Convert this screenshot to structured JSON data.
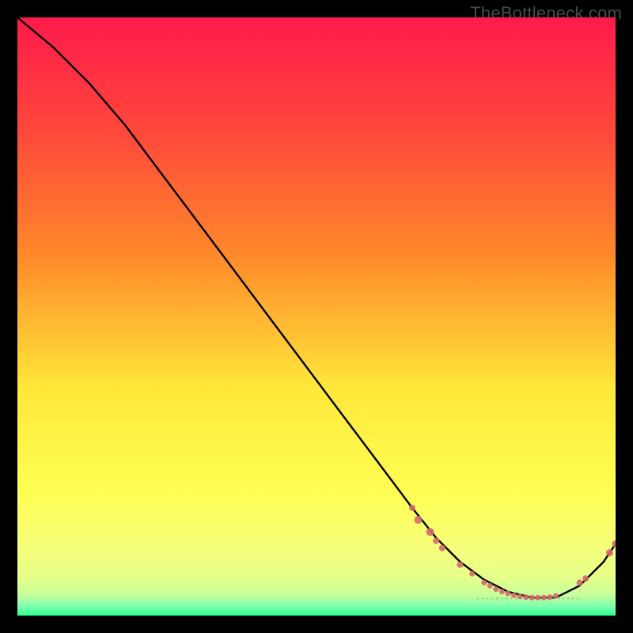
{
  "watermark": "TheBottleneck.com",
  "colors": {
    "bg": "#000000",
    "grad_top": "#ff1a4b",
    "grad_mid1": "#ff8a2a",
    "grad_mid2": "#ffe83a",
    "grad_low1": "#f6ff7a",
    "grad_low2": "#c9ff9a",
    "grad_bottom": "#2cff88",
    "line": "#000000",
    "marker": "#d46a6a",
    "watermark": "#4a4a4a"
  },
  "chart_data": {
    "type": "line",
    "title": "",
    "xlabel": "",
    "ylabel": "",
    "xlim": [
      0,
      100
    ],
    "ylim": [
      0,
      100
    ],
    "series": [
      {
        "name": "curve",
        "x": [
          0,
          6,
          12,
          18,
          24,
          30,
          36,
          42,
          48,
          54,
          60,
          66,
          70,
          74,
          78,
          82,
          86,
          90,
          94,
          98,
          100
        ],
        "y": [
          100,
          95,
          89,
          82,
          74,
          66,
          58,
          50,
          42,
          34,
          26,
          18,
          13,
          9,
          6,
          4,
          3,
          3,
          5,
          9,
          12
        ]
      }
    ],
    "markers": [
      {
        "x": 66,
        "y": 18,
        "r": 4
      },
      {
        "x": 67,
        "y": 16,
        "r": 5
      },
      {
        "x": 69,
        "y": 14,
        "r": 5
      },
      {
        "x": 70,
        "y": 12.5,
        "r": 4
      },
      {
        "x": 71,
        "y": 11.3,
        "r": 4
      },
      {
        "x": 74,
        "y": 8.5,
        "r": 4
      },
      {
        "x": 76,
        "y": 7,
        "r": 3.5
      },
      {
        "x": 78,
        "y": 5.5,
        "r": 3.5
      },
      {
        "x": 79,
        "y": 5,
        "r": 3.5
      },
      {
        "x": 80,
        "y": 4.4,
        "r": 3.5
      },
      {
        "x": 81,
        "y": 4,
        "r": 3.5
      },
      {
        "x": 82,
        "y": 3.7,
        "r": 3.5
      },
      {
        "x": 83,
        "y": 3.4,
        "r": 3.5
      },
      {
        "x": 84,
        "y": 3.2,
        "r": 3.5
      },
      {
        "x": 85,
        "y": 3.1,
        "r": 3.5
      },
      {
        "x": 86,
        "y": 3,
        "r": 3.5
      },
      {
        "x": 87,
        "y": 3,
        "r": 3.5
      },
      {
        "x": 88,
        "y": 3,
        "r": 3.5
      },
      {
        "x": 89,
        "y": 3.1,
        "r": 3.5
      },
      {
        "x": 90,
        "y": 3.3,
        "r": 3.5
      },
      {
        "x": 94,
        "y": 5.5,
        "r": 4
      },
      {
        "x": 95,
        "y": 6.2,
        "r": 4
      },
      {
        "x": 99,
        "y": 10.5,
        "r": 4.5
      },
      {
        "x": 100,
        "y": 12,
        "r": 4.5
      }
    ],
    "annotation": {
      "text": "",
      "x": 84,
      "y": 3
    },
    "background_bands": [
      {
        "y0": 100,
        "y1": 24,
        "from": "grad_top",
        "to": "grad_mid2"
      },
      {
        "y0": 24,
        "y1": 10,
        "from": "grad_mid2",
        "to": "grad_low1"
      },
      {
        "y0": 10,
        "y1": 4,
        "from": "grad_low1",
        "to": "grad_low2"
      },
      {
        "y0": 4,
        "y1": 0,
        "from": "grad_low2",
        "to": "grad_bottom"
      }
    ]
  }
}
